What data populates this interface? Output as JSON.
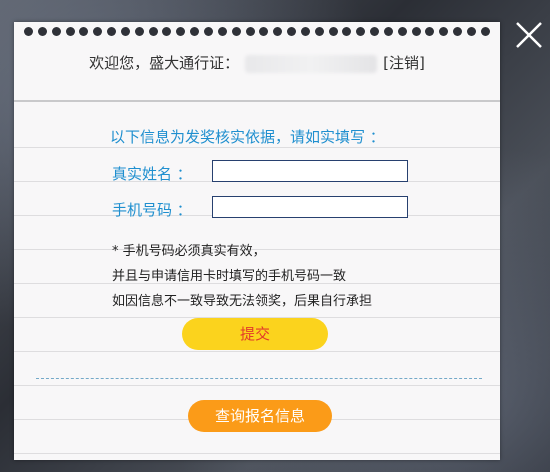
{
  "header": {
    "welcome_text": "欢迎您，盛大通行证：",
    "logout_label": "[注销]"
  },
  "form": {
    "intro": "以下信息为发奖核实依据，请如实填写 ：",
    "name_label": "真实姓名 ：",
    "name_value": "",
    "phone_label": "手机号码 ：",
    "phone_value": ""
  },
  "notes": [
    "* 手机号码必须真实有效，",
    "并且与申请信用卡时填写的手机号码一致",
    "如因信息不一致导致无法领奖，后果自行承担"
  ],
  "buttons": {
    "submit_label": "提交",
    "query_label": "查询报名信息"
  },
  "colors": {
    "accent_blue": "#1f8fcf",
    "submit_yellow": "#fbd31d",
    "query_orange": "#fb9b18"
  },
  "icons": {
    "close": "close-icon"
  }
}
